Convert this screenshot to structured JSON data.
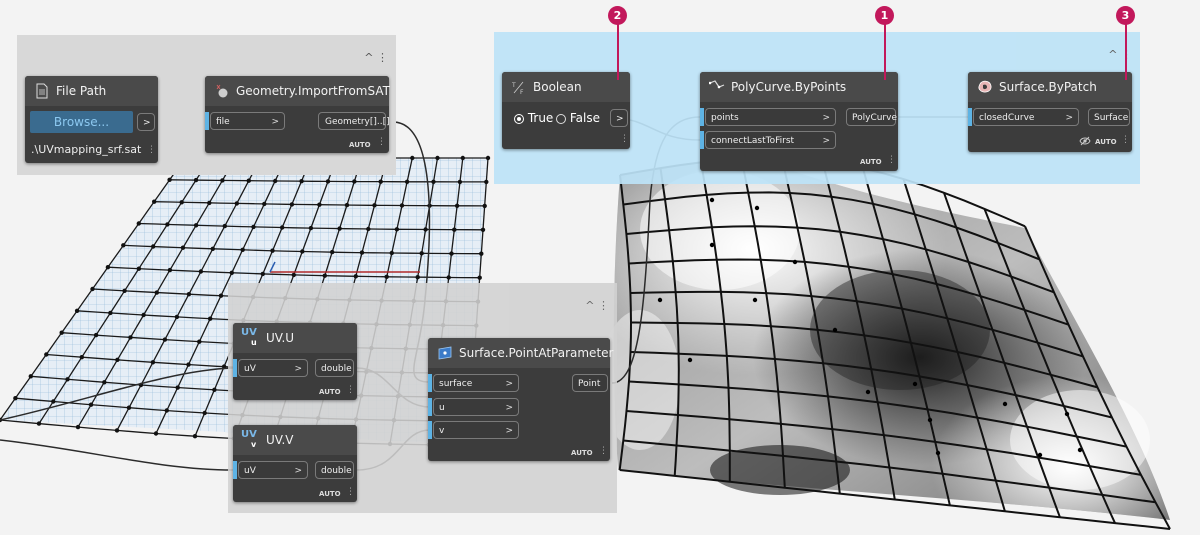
{
  "colors": {
    "group_gray": "#d8d8d8",
    "group_blue": "#bde3f7",
    "node_body": "#3c3c3c",
    "node_header": "#4a4a4a",
    "port_highlight": "#5eb3e4",
    "browse_button": "#3a6b8f",
    "browse_text": "#8cc8f0",
    "badge": "#c2185b",
    "wire": "#2b2b2b"
  },
  "callouts": {
    "one": "1",
    "two": "2",
    "three": "3"
  },
  "nodes": {
    "file_path": {
      "title": "File Path",
      "icon": "document-icon",
      "browse_label": "Browse...",
      "output_arrow": ">",
      "path_value": ".\\UVmapping_srf.sat"
    },
    "import_sat": {
      "title": "Geometry.ImportFromSAT",
      "icon": "import-geometry-icon",
      "input": "file",
      "output": "Geometry[]..[]",
      "lacing": "AUTO"
    },
    "boolean": {
      "title": "Boolean",
      "icon": "true-false-icon",
      "true_label": "True",
      "false_label": "False",
      "selected": "True",
      "output_arrow": ">"
    },
    "polycurve": {
      "title": "PolyCurve.ByPoints",
      "icon": "polycurve-icon",
      "inputs": [
        "points",
        "connectLastToFirst"
      ],
      "output": "PolyCurve",
      "lacing": "AUTO"
    },
    "surface_patch": {
      "title": "Surface.ByPatch",
      "icon": "surface-patch-icon",
      "input": "closedCurve",
      "output": "Surface",
      "lacing": "AUTO",
      "preview_icon": "eye-off-icon"
    },
    "uv_u": {
      "title": "UV.U",
      "icon": "uv-u-icon",
      "input": "uV",
      "output": "double",
      "lacing": "AUTO"
    },
    "uv_v": {
      "title": "UV.V",
      "icon": "uv-v-icon",
      "input": "uV",
      "output": "double",
      "lacing": "AUTO"
    },
    "point_at_param": {
      "title": "Surface.PointAtParameter",
      "icon": "surface-point-icon",
      "inputs": [
        "surface",
        "u",
        "v"
      ],
      "output": "Point",
      "lacing": "AUTO"
    }
  },
  "group_control": "^ ⋮"
}
